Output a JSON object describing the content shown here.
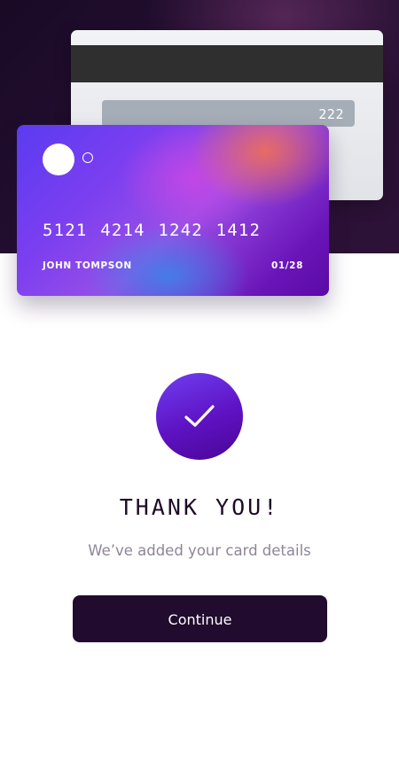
{
  "card_back": {
    "cvc": "222"
  },
  "card_front": {
    "number": "5121 4214 1242 1412",
    "holder_name": "JOHN TOMPSON",
    "expiry": "01/28"
  },
  "confirmation": {
    "icon": "checkmark-icon",
    "title": "THANK YOU!",
    "message": "We’ve added your card details"
  },
  "actions": {
    "continue_label": "Continue"
  },
  "colors": {
    "hero_background": "#261033",
    "accent": "#5e12c2",
    "button": "#210b2e",
    "title_text": "#1d0b26",
    "subtitle_text": "#8e8598"
  }
}
